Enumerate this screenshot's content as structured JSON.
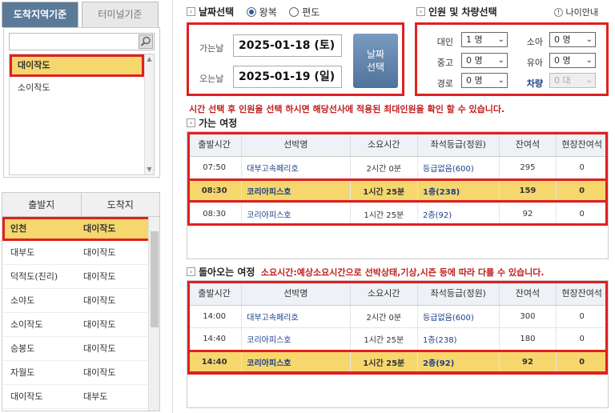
{
  "left": {
    "tab_active": "도착지역기준",
    "tab_inactive": "터미널기준",
    "destinations": [
      "대이작도",
      "소이작도"
    ],
    "route_header": {
      "departure": "출발지",
      "arrival": "도착지"
    },
    "routes": [
      {
        "from": "인천",
        "to": "대이작도"
      },
      {
        "from": "대부도",
        "to": "대이작도"
      },
      {
        "from": "덕적도(진리)",
        "to": "대이작도"
      },
      {
        "from": "소야도",
        "to": "대이작도"
      },
      {
        "from": "소이작도",
        "to": "대이작도"
      },
      {
        "from": "승봉도",
        "to": "대이작도"
      },
      {
        "from": "자월도",
        "to": "대이작도"
      },
      {
        "from": "대이작도",
        "to": "대부도"
      }
    ]
  },
  "date": {
    "title": "날짜선택",
    "round_trip": "왕복",
    "one_way": "편도",
    "go_label": "가는날",
    "go_value": "2025-01-18 (토)",
    "return_label": "오는날",
    "return_value": "2025-01-19 (일)",
    "button": "날짜\n선택"
  },
  "pax": {
    "title": "인원 및 차량선택",
    "age_guide": "나이안내",
    "adult_label": "대인",
    "adult_value": "1 명",
    "child_label": "소아",
    "child_value": "0 명",
    "teen_label": "중고",
    "teen_value": "0 명",
    "infant_label": "유아",
    "infant_value": "0 명",
    "senior_label": "경로",
    "senior_value": "0 명",
    "vehicle_label": "차량",
    "vehicle_value": "0 대"
  },
  "notice": "시간 선택 후 인원을 선택 하시면 해당선사에 적용된 최대인원을 확인 할 수 있습니다.",
  "outbound_title": "가는 여정",
  "return_title": "돌아오는 여정",
  "return_note": "소요시간:예상소요시간으로 선박상태,기상,시즌 등에 따라 다를 수 있습니다.",
  "columns": [
    "출발시간",
    "선박명",
    "소요시간",
    "좌석등급(정원)",
    "잔여석",
    "현장잔여석"
  ],
  "outbound": [
    {
      "time": "07:50",
      "ship": "대부고속페리호",
      "duration": "2시간 0분",
      "grade": "등급없음(600)",
      "seats": "295",
      "onsite": "0",
      "selected": false
    },
    {
      "time": "08:30",
      "ship": "코리아피스호",
      "duration": "1시간 25분",
      "grade": "1층(238)",
      "seats": "159",
      "onsite": "0",
      "selected": true
    },
    {
      "time": "08:30",
      "ship": "코리아피스호",
      "duration": "1시간 25분",
      "grade": "2층(92)",
      "seats": "92",
      "onsite": "0",
      "selected": false
    }
  ],
  "inbound": [
    {
      "time": "14:00",
      "ship": "대부고속페리호",
      "duration": "2시간 0분",
      "grade": "등급없음(600)",
      "seats": "300",
      "onsite": "0",
      "selected": false
    },
    {
      "time": "14:40",
      "ship": "코리아피스호",
      "duration": "1시간 25분",
      "grade": "1층(238)",
      "seats": "180",
      "onsite": "0",
      "selected": false
    },
    {
      "time": "14:40",
      "ship": "코리아피스호",
      "duration": "1시간 25분",
      "grade": "2층(92)",
      "seats": "92",
      "onsite": "0",
      "selected": true
    }
  ]
}
